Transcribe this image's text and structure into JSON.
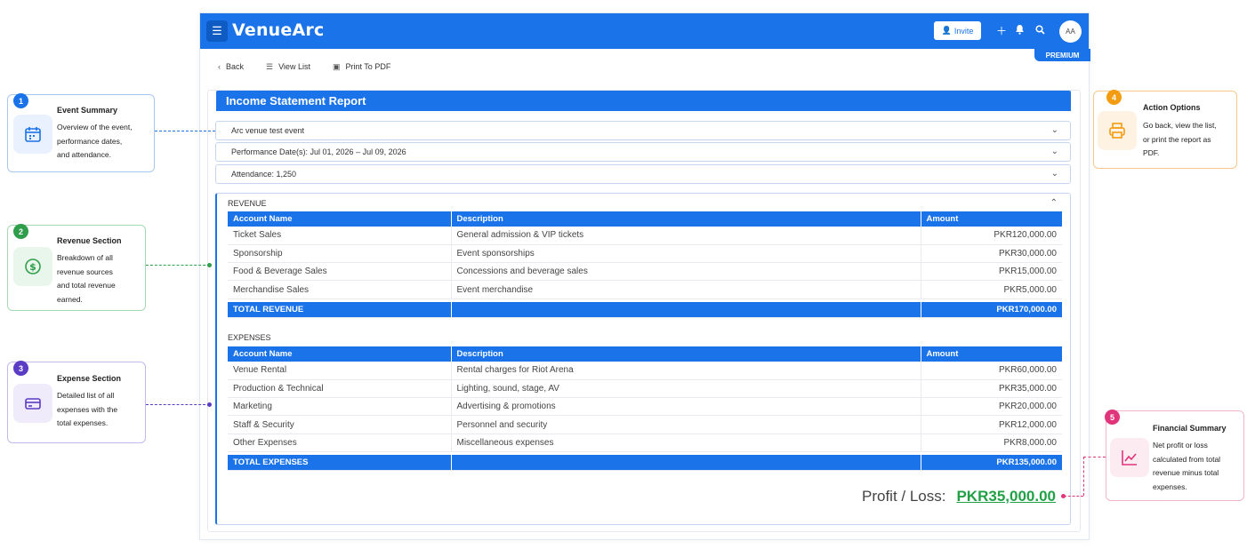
{
  "app": {
    "logo": "VenueArc",
    "menu_icon": "hamburger-icon",
    "invite_label": "Invite",
    "avatar_initials": "AA",
    "premium_badge": "PREMIUM"
  },
  "toolbar": {
    "back_label": "Back",
    "view_list_label": "View List",
    "print_label": "Print To PDF"
  },
  "report": {
    "title": "Income Statement Report",
    "event_name": "Arc venue test event",
    "performance_dates": "Performance Date(s): Jul 01, 2026 – Jul 09, 2026",
    "attendance": "Attendance: 1,250"
  },
  "revenue": {
    "label": "REVENUE",
    "columns": [
      "Account Name",
      "Description",
      "Amount"
    ],
    "rows": [
      {
        "account": "Ticket Sales",
        "description": "General admission & VIP tickets",
        "amount": "PKR120,000.00"
      },
      {
        "account": "Sponsorship",
        "description": "Event sponsorships",
        "amount": "PKR30,000.00"
      },
      {
        "account": "Food & Beverage Sales",
        "description": "Concessions and beverage sales",
        "amount": "PKR15,000.00"
      },
      {
        "account": "Merchandise Sales",
        "description": "Event merchandise",
        "amount": "PKR5,000.00"
      }
    ],
    "total_label": "TOTAL REVENUE",
    "total_amount": "PKR170,000.00"
  },
  "expenses": {
    "label": "EXPENSES",
    "columns": [
      "Account Name",
      "Description",
      "Amount"
    ],
    "rows": [
      {
        "account": "Venue Rental",
        "description": "Rental charges for Riot Arena",
        "amount": "PKR60,000.00"
      },
      {
        "account": "Production & Technical",
        "description": "Lighting, sound, stage, AV",
        "amount": "PKR35,000.00"
      },
      {
        "account": "Marketing",
        "description": "Advertising & promotions",
        "amount": "PKR20,000.00"
      },
      {
        "account": "Staff & Security",
        "description": "Personnel and security",
        "amount": "PKR12,000.00"
      },
      {
        "account": "Other Expenses",
        "description": "Miscellaneous expenses",
        "amount": "PKR8,000.00"
      }
    ],
    "total_label": "TOTAL EXPENSES",
    "total_amount": "PKR135,000.00"
  },
  "profit": {
    "label": "Profit / Loss:",
    "value": "PKR35,000.00"
  },
  "callouts": [
    {
      "num": "1",
      "title": "Event Summary",
      "desc": [
        "Overview of the event,",
        "performance dates,",
        "and attendance."
      ],
      "color": "#1a73e8",
      "icon": "calendar-icon"
    },
    {
      "num": "2",
      "title": "Revenue Section",
      "desc": [
        "Breakdown of all",
        "revenue sources",
        "and total revenue",
        "earned."
      ],
      "color": "#2e9e4a",
      "icon": "dollar-circle-icon"
    },
    {
      "num": "3",
      "title": "Expense Section",
      "desc": [
        "Detailed list of all",
        "expenses with the",
        "total expenses."
      ],
      "color": "#5b3cc4",
      "icon": "credit-card-icon"
    },
    {
      "num": "4",
      "title": "Action Options",
      "desc": [
        "Go back, view the list,",
        "or print the report as",
        "PDF."
      ],
      "color": "#f39c12",
      "icon": "printer-icon"
    },
    {
      "num": "5",
      "title": "Financial Summary",
      "desc": [
        "Net profit or loss",
        "calculated from total",
        "revenue minus total",
        "expenses."
      ],
      "color": "#e0357a",
      "icon": "chart-line-icon"
    }
  ]
}
